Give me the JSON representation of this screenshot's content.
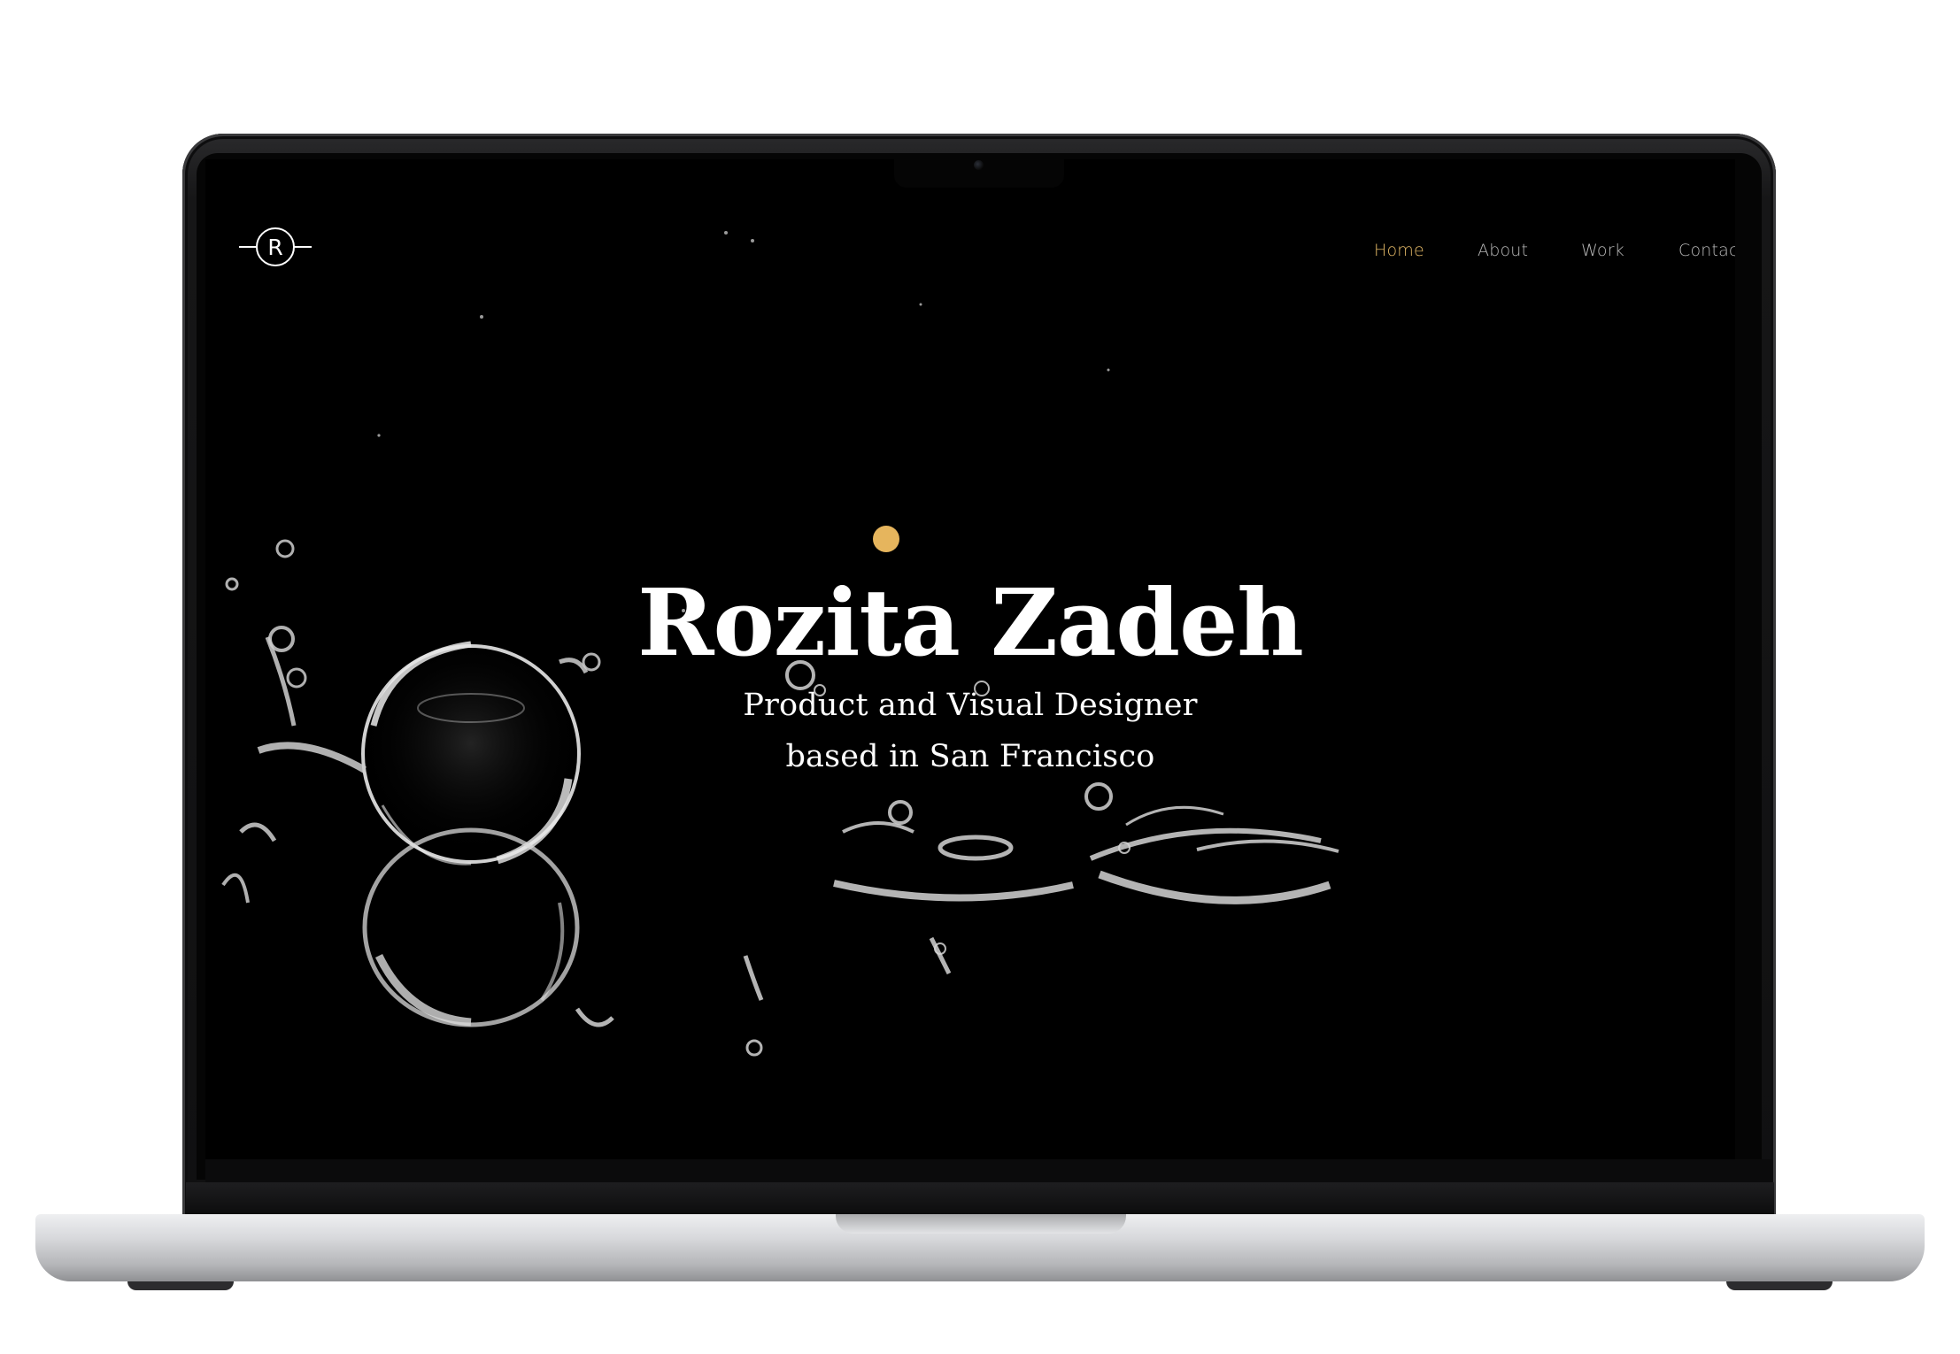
{
  "site": {
    "logo_letter": "R",
    "nav": {
      "items": [
        "Home",
        "About",
        "Work",
        "Contact"
      ],
      "active": "Home"
    },
    "hero": {
      "name": "Rozita Zadeh",
      "subtitle_line1": "Product and Visual Designer",
      "subtitle_line2": "based in San Francisco"
    }
  },
  "colors": {
    "accent": "#e6b55d",
    "nav_active": "#e3b866",
    "nav_inactive": "#b8b8b8",
    "background": "#000000",
    "text": "#ffffff"
  },
  "icons": {
    "logo": "circled-r-logo-icon",
    "camera": "webcam-icon"
  }
}
